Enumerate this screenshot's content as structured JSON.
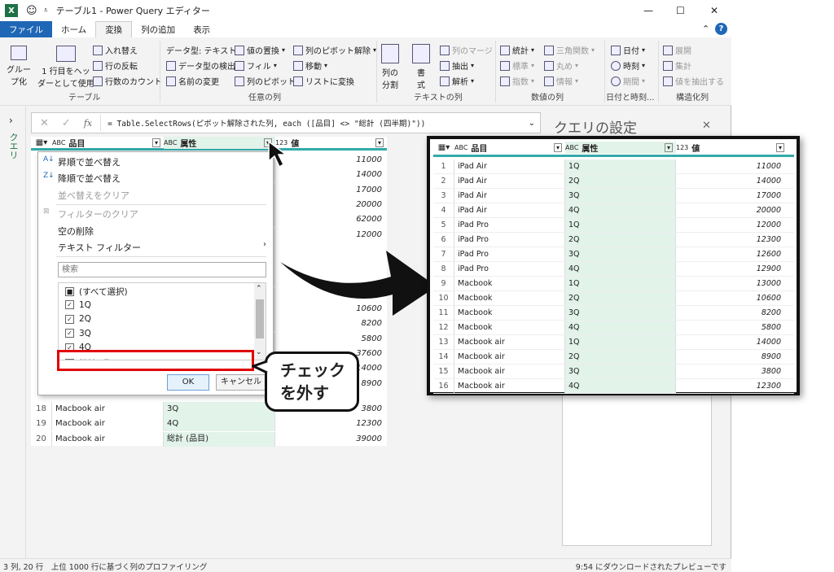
{
  "window": {
    "title": "テーブル1 - Power Query エディター",
    "minimize": "—",
    "maximize": "☐",
    "close": "✕"
  },
  "menu": [
    "ファイル",
    "ホーム",
    "変換",
    "列の追加",
    "表示"
  ],
  "ribbon": {
    "table_group": {
      "label": "テーブル",
      "group_by": "グルー\nプ化",
      "use_first_row": "1 行目をヘッ\nダーとして使用",
      "transpose": "入れ替え",
      "reverse_rows": "行の反転",
      "count_rows": "行数のカウント"
    },
    "any_column_group": {
      "label": "任意の列",
      "data_type": "データ型: テキスト",
      "detect_type": "データ型の検出",
      "rename": "名前の変更",
      "replace_values": "値の置換",
      "fill": "フィル",
      "pivot": "列のピボット",
      "unpivot": "列のピボット解除",
      "move": "移動",
      "to_list": "リストに変換"
    },
    "text_group": {
      "label": "テキストの列",
      "split": "列の\n分割",
      "format": "書\n式",
      "merge": "列のマージ",
      "extract": "抽出",
      "parse": "解析"
    },
    "number_group": {
      "label": "数値の列",
      "stats": "統計",
      "standard": "標準",
      "scientific": "指数",
      "trig": "三角関数",
      "rounding": "丸め",
      "info": "情報"
    },
    "datetime_group": {
      "label": "日付と時刻...",
      "date": "日付",
      "time": "時刻",
      "duration": "期間"
    },
    "structured_group": {
      "label": "構造化列",
      "expand": "展開",
      "aggregate": "集計",
      "extract_values": "値を抽出する"
    }
  },
  "side_label": "クエリ",
  "formula": "= Table.SelectRows(ピボット解除された列, each ([品目] <> \"総計 (四半期)\"))",
  "settings_title": "クエリの設定",
  "columns": [
    {
      "type": "ABC",
      "name": "品目"
    },
    {
      "type": "ABC",
      "name": "属性"
    },
    {
      "type": "123",
      "name": "値"
    }
  ],
  "back_values": [
    "11000",
    "14000",
    "17000",
    "20000",
    "62000",
    "12000",
    "",
    "",
    "",
    "13000",
    "10600",
    "8200",
    "5800",
    "37600",
    "14000",
    "8900"
  ],
  "back_rows": [
    {
      "n": "18",
      "item": "Macbook air",
      "attr": "3Q",
      "val": "3800"
    },
    {
      "n": "19",
      "item": "Macbook air",
      "attr": "4Q",
      "val": "12300"
    },
    {
      "n": "20",
      "item": "Macbook air",
      "attr": "総計 (品目)",
      "val": "39000"
    }
  ],
  "dropdown": {
    "sort_asc": "昇順で並べ替え",
    "sort_desc": "降順で並べ替え",
    "clear_sort": "並べ替えをクリア",
    "clear_filter": "フィルターのクリア",
    "remove_empty": "空の削除",
    "text_filter": "テキスト フィルター",
    "search_placeholder": "検索",
    "items": [
      {
        "label": "(すべて選択)",
        "state": "partial"
      },
      {
        "label": "1Q",
        "state": "checked"
      },
      {
        "label": "2Q",
        "state": "checked"
      },
      {
        "label": "3Q",
        "state": "checked"
      },
      {
        "label": "4Q",
        "state": "checked"
      },
      {
        "label": "総計 (品目)",
        "state": "unchecked"
      }
    ],
    "ok": "OK",
    "cancel": "キャンセル"
  },
  "callout": "チェック\nを外す",
  "status_left": "3 列, 20 行　上位 1000 行に基づく列のプロファイリング",
  "status_right": "9:54 にダウンロードされたプレビューです",
  "filtered_rows": [
    {
      "n": "1",
      "item": "iPad Air",
      "attr": "1Q",
      "val": "11000"
    },
    {
      "n": "2",
      "item": "iPad Air",
      "attr": "2Q",
      "val": "14000"
    },
    {
      "n": "3",
      "item": "iPad Air",
      "attr": "3Q",
      "val": "17000"
    },
    {
      "n": "4",
      "item": "iPad Air",
      "attr": "4Q",
      "val": "20000"
    },
    {
      "n": "5",
      "item": "iPad Pro",
      "attr": "1Q",
      "val": "12000"
    },
    {
      "n": "6",
      "item": "iPad Pro",
      "attr": "2Q",
      "val": "12300"
    },
    {
      "n": "7",
      "item": "iPad Pro",
      "attr": "3Q",
      "val": "12600"
    },
    {
      "n": "8",
      "item": "iPad Pro",
      "attr": "4Q",
      "val": "12900"
    },
    {
      "n": "9",
      "item": "Macbook",
      "attr": "1Q",
      "val": "13000"
    },
    {
      "n": "10",
      "item": "Macbook",
      "attr": "2Q",
      "val": "10600"
    },
    {
      "n": "11",
      "item": "Macbook",
      "attr": "3Q",
      "val": "8200"
    },
    {
      "n": "12",
      "item": "Macbook",
      "attr": "4Q",
      "val": "5800"
    },
    {
      "n": "13",
      "item": "Macbook air",
      "attr": "1Q",
      "val": "14000"
    },
    {
      "n": "14",
      "item": "Macbook air",
      "attr": "2Q",
      "val": "8900"
    },
    {
      "n": "15",
      "item": "Macbook air",
      "attr": "3Q",
      "val": "3800"
    },
    {
      "n": "16",
      "item": "Macbook air",
      "attr": "4Q",
      "val": "12300"
    }
  ]
}
